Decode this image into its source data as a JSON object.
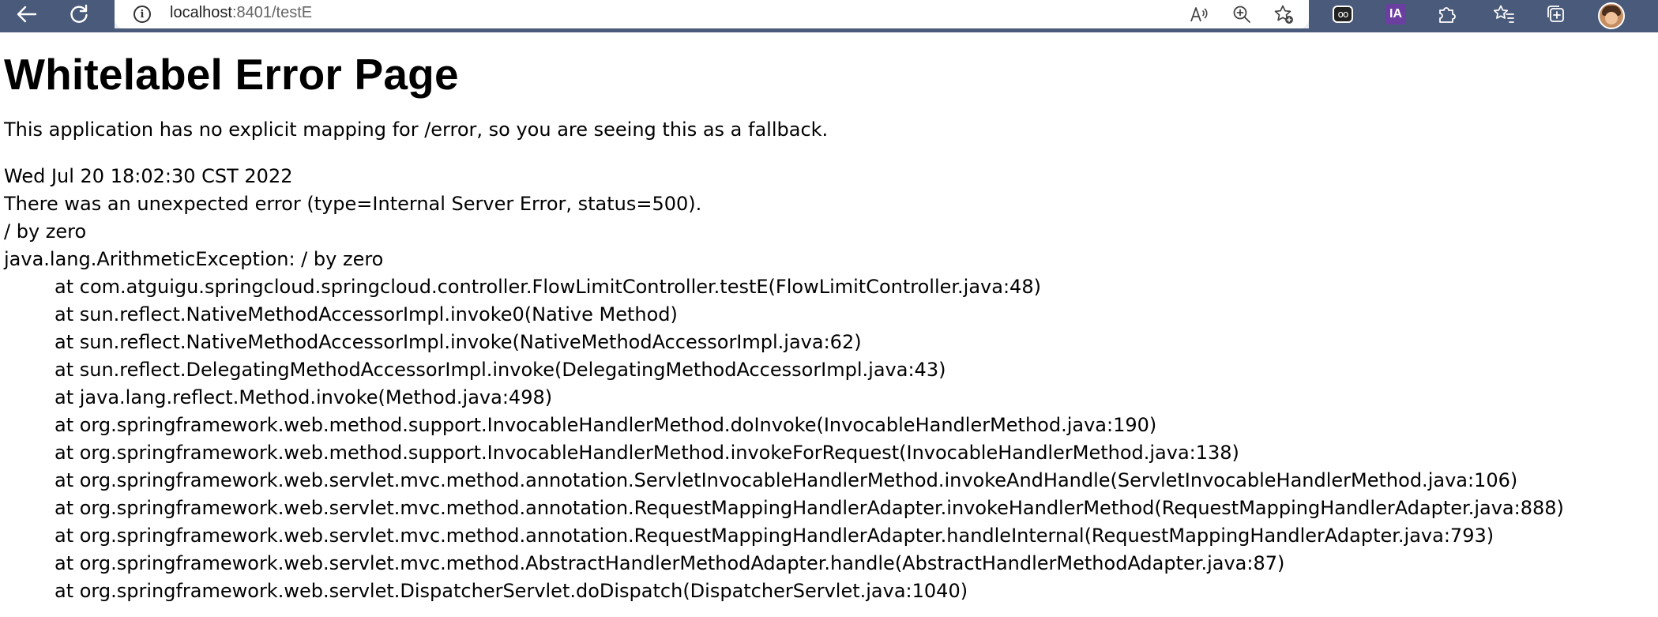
{
  "browser": {
    "url_host": "localhost",
    "url_rest": ":8401/testE",
    "nav_icons": [
      "back-icon",
      "refresh-icon"
    ],
    "address_icons": [
      "read-aloud-icon",
      "zoom-icon",
      "add-favorite-icon"
    ],
    "extension_icons": [
      "extension-mask-icon",
      "ia-extension-icon",
      "extensions-puzzle-icon",
      "favorites-icon",
      "collections-icon",
      "profile-avatar"
    ],
    "ia_label": "IA",
    "mask_glyph": "oo"
  },
  "page": {
    "title": "Whitelabel Error Page",
    "fallback_message": "This application has no explicit mapping for /error, so you are seeing this as a fallback.",
    "timestamp": "Wed Jul 20 18:02:30 CST 2022",
    "error_summary": "There was an unexpected error (type=Internal Server Error, status=500).",
    "message": "/ by zero",
    "exception": "java.lang.ArithmeticException: / by zero",
    "stack_trace": [
      "at com.atguigu.springcloud.springcloud.controller.FlowLimitController.testE(FlowLimitController.java:48)",
      "at sun.reflect.NativeMethodAccessorImpl.invoke0(Native Method)",
      "at sun.reflect.NativeMethodAccessorImpl.invoke(NativeMethodAccessorImpl.java:62)",
      "at sun.reflect.DelegatingMethodAccessorImpl.invoke(DelegatingMethodAccessorImpl.java:43)",
      "at java.lang.reflect.Method.invoke(Method.java:498)",
      "at org.springframework.web.method.support.InvocableHandlerMethod.doInvoke(InvocableHandlerMethod.java:190)",
      "at org.springframework.web.method.support.InvocableHandlerMethod.invokeForRequest(InvocableHandlerMethod.java:138)",
      "at org.springframework.web.servlet.mvc.method.annotation.ServletInvocableHandlerMethod.invokeAndHandle(ServletInvocableHandlerMethod.java:106)",
      "at org.springframework.web.servlet.mvc.method.annotation.RequestMappingHandlerAdapter.invokeHandlerMethod(RequestMappingHandlerAdapter.java:888)",
      "at org.springframework.web.servlet.mvc.method.annotation.RequestMappingHandlerAdapter.handleInternal(RequestMappingHandlerAdapter.java:793)",
      "at org.springframework.web.servlet.mvc.method.AbstractHandlerMethodAdapter.handle(AbstractHandlerMethodAdapter.java:87)",
      "at org.springframework.web.servlet.DispatcherServlet.doDispatch(DispatcherServlet.java:1040)"
    ]
  }
}
